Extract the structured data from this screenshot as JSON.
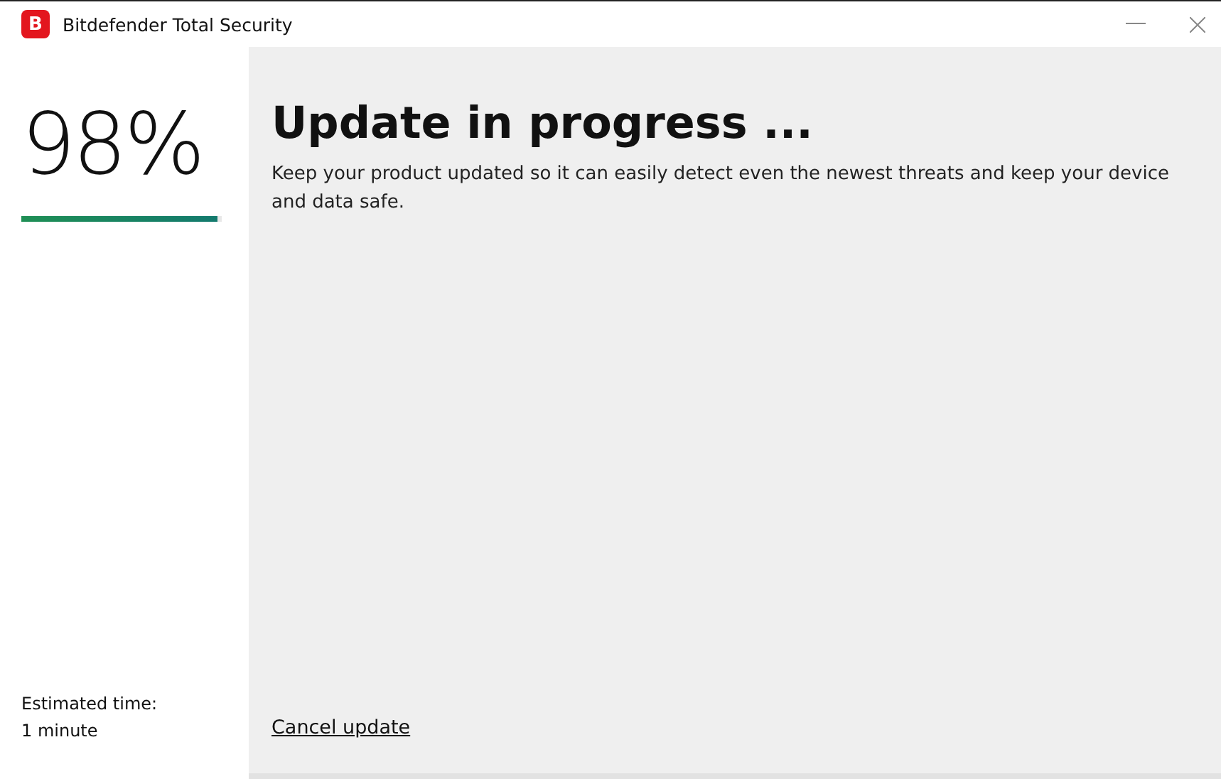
{
  "window": {
    "logo": "B",
    "title": "Bitdefender Total Security"
  },
  "progress": {
    "percent": "98%",
    "level": 0.98,
    "estimate_label": "Estimated time:",
    "estimate_value": "1 minute"
  },
  "main": {
    "heading": "Update in progress ...",
    "description": "Keep your product updated so it can easily detect even the newest threats and keep your device and data safe.",
    "cancel_link": "Cancel update"
  }
}
